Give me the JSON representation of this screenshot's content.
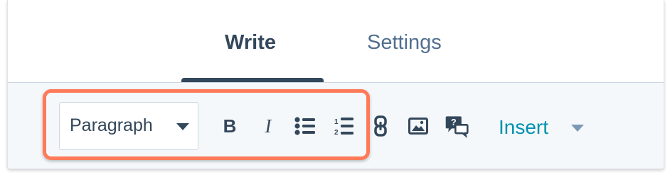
{
  "tabs": {
    "write_label": "Write",
    "settings_label": "Settings",
    "active": "Write"
  },
  "toolbar": {
    "paragraph_dropdown": {
      "selected": "Paragraph"
    },
    "bold_label": "B",
    "italic_label": "I",
    "numbered_list_digits": [
      "1",
      "2"
    ],
    "comment_icon_glyph": "?",
    "insert_label": "Insert",
    "icons": [
      "bold-icon",
      "italic-icon",
      "bulleted-list-icon",
      "numbered-list-icon",
      "link-icon",
      "image-icon",
      "comment-icon",
      "chevron-down-icon"
    ]
  },
  "colors": {
    "accent": "#0091ae",
    "text_dark": "#33475b",
    "text_muted": "#516f90",
    "toolbar_bg": "#f5f8fa",
    "highlight": "#ff7a59"
  }
}
